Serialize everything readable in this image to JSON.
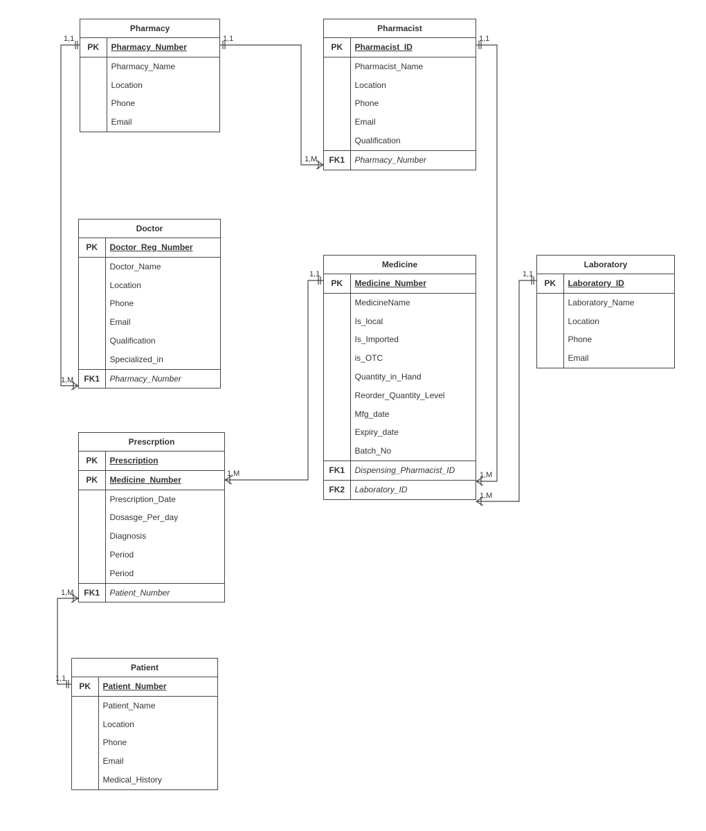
{
  "entities": {
    "pharmacy": {
      "title": "Pharmacy",
      "rows": [
        {
          "key": "PK",
          "name": "Pharmacy_Number",
          "pk": true
        },
        {
          "key": "",
          "name": "Pharmacy_Name",
          "sep": true
        },
        {
          "key": "",
          "name": "Location"
        },
        {
          "key": "",
          "name": "Phone"
        },
        {
          "key": "",
          "name": "Email"
        }
      ]
    },
    "pharmacist": {
      "title": "Pharmacist",
      "rows": [
        {
          "key": "PK",
          "name": "Pharmacist_ID",
          "pk": true
        },
        {
          "key": "",
          "name": "Pharmacist_Name",
          "sep": true
        },
        {
          "key": "",
          "name": "Location"
        },
        {
          "key": "",
          "name": "Phone"
        },
        {
          "key": "",
          "name": "Email"
        },
        {
          "key": "",
          "name": "Qualification"
        },
        {
          "key": "FK1",
          "name": "Pharmacy_Number",
          "fk": true,
          "sep": true
        }
      ]
    },
    "doctor": {
      "title": "Doctor",
      "rows": [
        {
          "key": "PK",
          "name": "Doctor_Reg_Number",
          "pk": true
        },
        {
          "key": "",
          "name": "Doctor_Name",
          "sep": true
        },
        {
          "key": "",
          "name": "Location"
        },
        {
          "key": "",
          "name": "Phone"
        },
        {
          "key": "",
          "name": "Email"
        },
        {
          "key": "",
          "name": "Qualification"
        },
        {
          "key": "",
          "name": "Specialized_in"
        },
        {
          "key": "FK1",
          "name": "Pharmacy_Number",
          "fk": true,
          "sep": true
        }
      ]
    },
    "prescription": {
      "title": "Prescrption",
      "rows": [
        {
          "key": "PK",
          "name": "Prescription",
          "pk": true
        },
        {
          "key": "PK",
          "name": "Medicine_Number",
          "pk": true,
          "sep": true
        },
        {
          "key": "",
          "name": "Prescription_Date",
          "sep": true
        },
        {
          "key": "",
          "name": "Dosasge_Per_day"
        },
        {
          "key": "",
          "name": "Diagnosis"
        },
        {
          "key": "",
          "name": "Period"
        },
        {
          "key": "",
          "name": "Period"
        },
        {
          "key": "FK1",
          "name": "Patient_Number",
          "fk": true,
          "sep": true
        }
      ]
    },
    "patient": {
      "title": "Patient",
      "rows": [
        {
          "key": "PK",
          "name": "Patient_Number",
          "pk": true
        },
        {
          "key": "",
          "name": "Patient_Name",
          "sep": true
        },
        {
          "key": "",
          "name": "Location"
        },
        {
          "key": "",
          "name": "Phone"
        },
        {
          "key": "",
          "name": "Email"
        },
        {
          "key": "",
          "name": "Medical_History"
        }
      ]
    },
    "medicine": {
      "title": "Medicine",
      "rows": [
        {
          "key": "PK",
          "name": "Medicine_Number",
          "pk": true
        },
        {
          "key": "",
          "name": "MedicineName",
          "sep": true
        },
        {
          "key": "",
          "name": "Is_local"
        },
        {
          "key": "",
          "name": "Is_Imported"
        },
        {
          "key": "",
          "name": "is_OTC"
        },
        {
          "key": "",
          "name": "Quantity_in_Hand"
        },
        {
          "key": "",
          "name": "Reorder_Quantity_Level"
        },
        {
          "key": "",
          "name": "Mfg_date"
        },
        {
          "key": "",
          "name": "Expiry_date"
        },
        {
          "key": "",
          "name": "Batch_No"
        },
        {
          "key": "FK1",
          "name": "Dispensing_Pharmacist_ID",
          "fk": true,
          "sep": true
        },
        {
          "key": "FK2",
          "name": "Laboratory_ID",
          "fk": true,
          "sep": true
        }
      ]
    },
    "laboratory": {
      "title": "Laboratory",
      "rows": [
        {
          "key": "PK",
          "name": "Laboratory_ID",
          "pk": true
        },
        {
          "key": "",
          "name": "Laboratory_Name",
          "sep": true
        },
        {
          "key": "",
          "name": "Location"
        },
        {
          "key": "",
          "name": "Phone"
        },
        {
          "key": "",
          "name": "Email"
        }
      ]
    }
  },
  "cards": {
    "c1": "1,1",
    "c2": "1,1",
    "c3": "1,M",
    "c4": "1,M",
    "c5": "1,M",
    "c6": "1,1",
    "c7": "1,M",
    "c8": "1,1",
    "c9": "1,1",
    "c10": "1,M",
    "c11": "1,M",
    "c12": "1,1"
  }
}
